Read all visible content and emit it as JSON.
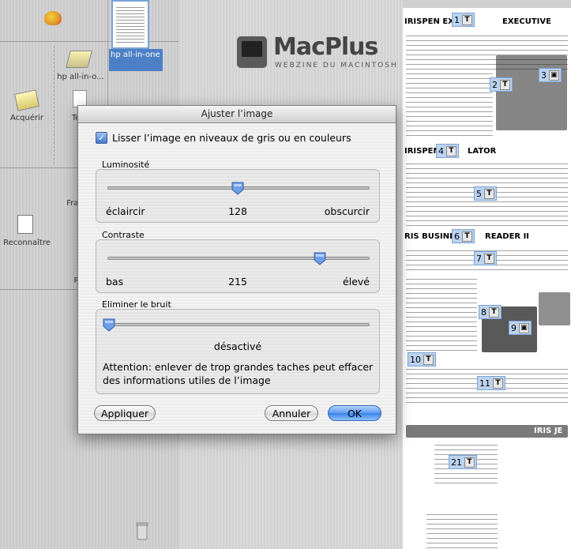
{
  "background": {
    "left_panel": {
      "acquire_label": "Acquérir",
      "recognize_label": "Reconnaître",
      "device_label": "hp all-in-o...",
      "partial_labels": [
        "Te",
        "Fran",
        "R"
      ]
    },
    "thumbnail_caption": "hp all-in-one",
    "logo": {
      "title": "MacPlus",
      "subtitle": "WEBZINE DU MACINTOSH"
    },
    "document": {
      "headings": [
        "IRISPEN EXP",
        "EXECUTIVE",
        "IRISPEN",
        "LATOR",
        "RIS BUSINE",
        "READER II",
        "IRIS JE"
      ],
      "zones": [
        "1",
        "2",
        "3",
        "4",
        "5",
        "6",
        "7",
        "8",
        "9",
        "10",
        "11",
        "21"
      ]
    }
  },
  "dialog": {
    "title": "Ajuster l’image",
    "smooth_checkbox": {
      "label": "Lisser l’image en niveaux de gris ou en couleurs",
      "checked": true
    },
    "brightness": {
      "label": "Luminosité",
      "min_label": "éclaircir",
      "value": "128",
      "max_label": "obscurcir",
      "fraction": 0.5
    },
    "contrast": {
      "label": "Contraste",
      "min_label": "bas",
      "value": "215",
      "max_label": "élevé",
      "fraction": 0.82
    },
    "noise": {
      "label": "Eliminer le bruit",
      "value": "désactivé",
      "fraction": 0.0,
      "warning": "Attention: enlever de trop grandes taches peut effacer des informations utiles de l’image"
    },
    "buttons": {
      "apply": "Appliquer",
      "cancel": "Annuler",
      "ok": "OK"
    },
    "colors": {
      "accent": "#3a82e8",
      "knob": "#6f9fe6"
    }
  }
}
